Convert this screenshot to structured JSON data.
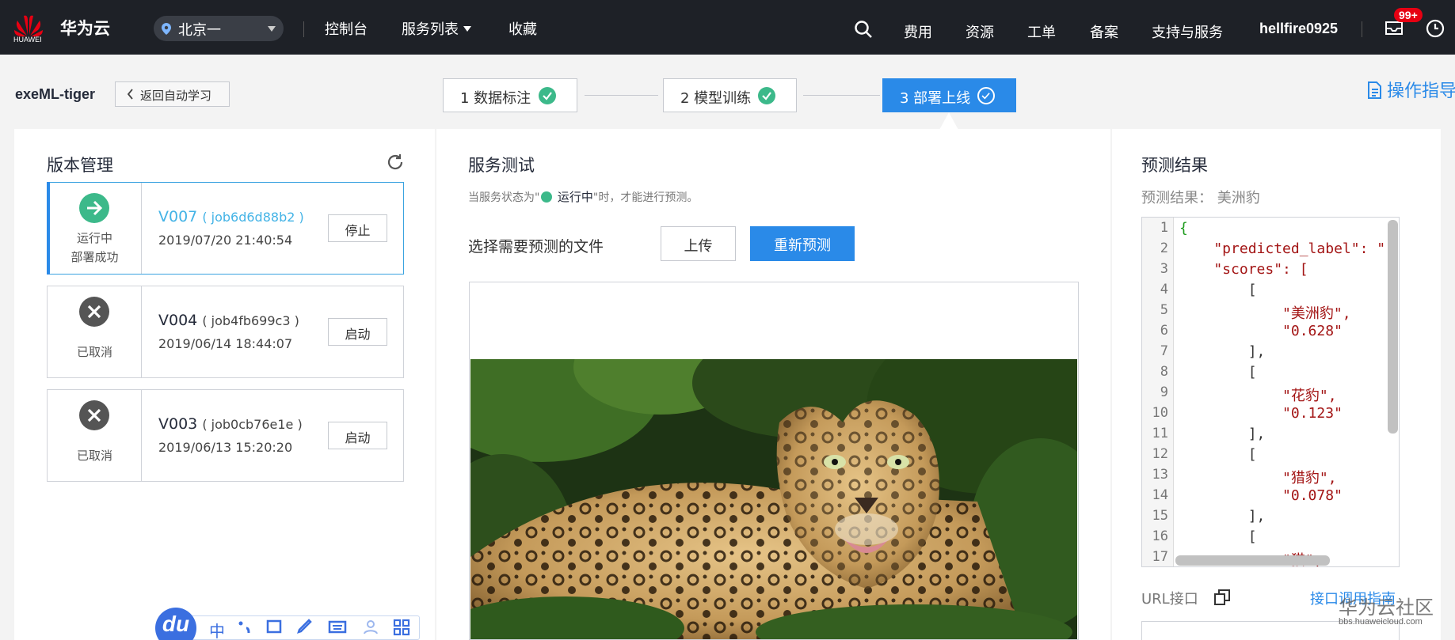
{
  "topbar": {
    "logo_text": "HUAWEI",
    "brand": "华为云",
    "region": "北京一",
    "nav": {
      "console": "控制台",
      "services": "服务列表",
      "favorites": "收藏",
      "fees": "费用",
      "resources": "资源",
      "tickets": "工单",
      "icp": "备案",
      "support": "支持与服务"
    },
    "username": "hellfire0925",
    "mail_badge": "99+"
  },
  "subheader": {
    "project_name": "exeML-tiger",
    "back_label": "返回自动学习",
    "steps": [
      {
        "label": "1 数据标注"
      },
      {
        "label": "2 模型训练"
      },
      {
        "label": "3 部署上线"
      }
    ],
    "guide_label": "操作指导"
  },
  "versions": {
    "title": "版本管理",
    "items": [
      {
        "status": "运行中",
        "status2": "部署成功",
        "name": "V007",
        "job": "( job6d6d88b2 )",
        "time": "2019/07/20 21:40:54",
        "action": "停止"
      },
      {
        "status": "已取消",
        "name": "V004",
        "job": "( job4fb699c3 )",
        "time": "2019/06/14 18:44:07",
        "action": "启动"
      },
      {
        "status": "已取消",
        "name": "V003",
        "job": "( job0cb76e1e )",
        "time": "2019/06/13 15:20:20",
        "action": "启动"
      }
    ]
  },
  "service_test": {
    "title": "服务测试",
    "hint_pre": "当服务状态为\"",
    "hint_running": "运行中",
    "hint_post": "\"时，才能进行预测。",
    "choose_label": "选择需要预测的文件",
    "upload_label": "上传",
    "repredict_label": "重新预测"
  },
  "prediction": {
    "title": "预测结果",
    "result_prefix": "预测结果：",
    "result_value": "美洲豹",
    "lines": [
      {
        "n": "1",
        "code": "{"
      },
      {
        "n": "2",
        "code": "    \"predicted_label\": \""
      },
      {
        "n": "3",
        "code": "    \"scores\": ["
      },
      {
        "n": "4",
        "code": "        ["
      },
      {
        "n": "5",
        "code": "            \"美洲豹\","
      },
      {
        "n": "6",
        "code": "            \"0.628\""
      },
      {
        "n": "7",
        "code": "        ],"
      },
      {
        "n": "8",
        "code": "        ["
      },
      {
        "n": "9",
        "code": "            \"花豹\","
      },
      {
        "n": "10",
        "code": "            \"0.123\""
      },
      {
        "n": "11",
        "code": "        ],"
      },
      {
        "n": "12",
        "code": "        ["
      },
      {
        "n": "13",
        "code": "            \"猎豹\","
      },
      {
        "n": "14",
        "code": "            \"0.078\""
      },
      {
        "n": "15",
        "code": "        ],"
      },
      {
        "n": "16",
        "code": "        ["
      },
      {
        "n": "17",
        "code": "            \"猫\","
      }
    ],
    "url_label": "URL接口",
    "api_guide_label": "接口调用指南"
  },
  "ime": {
    "logo": "du",
    "lang": "中"
  },
  "watermark": {
    "text": "华为云社区",
    "url": "bbs.huaweicloud.com"
  },
  "colors": {
    "accent": "#2a8ae8",
    "success": "#3cb98a",
    "nav_bg": "#1e2127",
    "badge": "#e60012"
  }
}
